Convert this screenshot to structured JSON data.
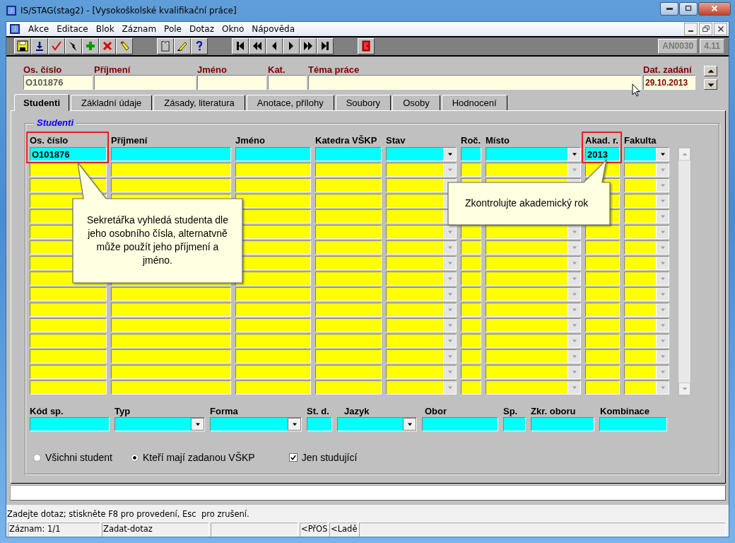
{
  "window": {
    "title": "IS/STAG(stag2) - [Vysokoškolské kvalifikační práce]"
  },
  "menu": [
    "Akce",
    "Editace",
    "Blok",
    "Záznam",
    "Pole",
    "Dotaz",
    "Okno",
    "Nápověda"
  ],
  "toolbar": {
    "form_code": "AN0030",
    "version": "4.11"
  },
  "header_fields": [
    {
      "label": "Os. číslo",
      "value": "O101876"
    },
    {
      "label": "Příjmení"
    },
    {
      "label": "Jméno"
    },
    {
      "label": "Kat."
    },
    {
      "label": "Téma práce"
    },
    {
      "label": "Dat. zadání",
      "value": "29.10.2013"
    }
  ],
  "tabs": [
    {
      "label": "Studenti",
      "selected": true
    },
    {
      "label": "Základní údaje",
      "selected": false
    },
    {
      "label": "Zásady, literatura",
      "selected": false
    },
    {
      "label": "Anotace, přílohy",
      "selected": false
    },
    {
      "label": "Soubory",
      "selected": false
    },
    {
      "label": "Osoby",
      "selected": false
    },
    {
      "label": "Hodnocení",
      "selected": false
    }
  ],
  "students": {
    "title": "Studenti",
    "columns": [
      {
        "header": "Os. číslo",
        "kind": "text",
        "value": "O101876",
        "highlighted": true
      },
      {
        "header": "Příjmení",
        "kind": "text",
        "highlighted": false
      },
      {
        "header": "Jméno",
        "kind": "text",
        "highlighted": false
      },
      {
        "header": "Katedra VŠKP",
        "kind": "text",
        "highlighted": false
      },
      {
        "header": "Stav",
        "kind": "dropdown",
        "highlighted": false
      },
      {
        "header": "Roč.",
        "kind": "text",
        "highlighted": false
      },
      {
        "header": "Místo",
        "kind": "dropdown",
        "highlighted": false
      },
      {
        "header": "Akad. r.",
        "kind": "text",
        "value": "2013",
        "highlighted": true
      },
      {
        "header": "Fakulta",
        "kind": "dropdown",
        "highlighted": false
      }
    ],
    "rows": [
      {
        "current": true
      },
      {
        "current": false
      },
      {
        "current": false
      },
      {
        "current": false
      },
      {
        "current": false
      },
      {
        "current": false
      },
      {
        "current": false
      },
      {
        "current": false
      },
      {
        "current": false
      },
      {
        "current": false
      },
      {
        "current": false
      },
      {
        "current": false
      },
      {
        "current": false
      },
      {
        "current": false
      },
      {
        "current": false
      },
      {
        "current": false
      }
    ]
  },
  "callouts": [
    {
      "text": "Sekretářka vyhledá studenta dle jeho osobního čísla, alternatvně může použít jeho příjmení a jméno."
    },
    {
      "text": "Zkontrolujte akademický rok"
    }
  ],
  "study_fields": [
    {
      "label": "Kód sp.",
      "kind": "text"
    },
    {
      "label": "Typ",
      "kind": "dropdown"
    },
    {
      "label": "Forma",
      "kind": "dropdown"
    },
    {
      "label": "St. d.",
      "kind": "text"
    },
    {
      "label": "Jazyk",
      "kind": "dropdown"
    },
    {
      "label": "Obor",
      "kind": "text"
    },
    {
      "label": "Sp.",
      "kind": "text"
    },
    {
      "label": "Zkr. oboru",
      "kind": "text"
    },
    {
      "label": "Kombinace",
      "kind": "text"
    }
  ],
  "filter": {
    "options": [
      {
        "label": "Všichni student",
        "selected": false
      },
      {
        "label": "Kteří mají zadanou VŠKP",
        "selected": true
      }
    ],
    "only_studying": {
      "label": "Jen studující",
      "checked": true
    }
  },
  "message": "Zadejte dotaz; stiskněte F8 pro provedení, Esc  pro zrušení.",
  "status_bar": [
    "Záznam: 1/1",
    "Zadat-dotaz",
    "<PřOS",
    "<Ladě"
  ]
}
